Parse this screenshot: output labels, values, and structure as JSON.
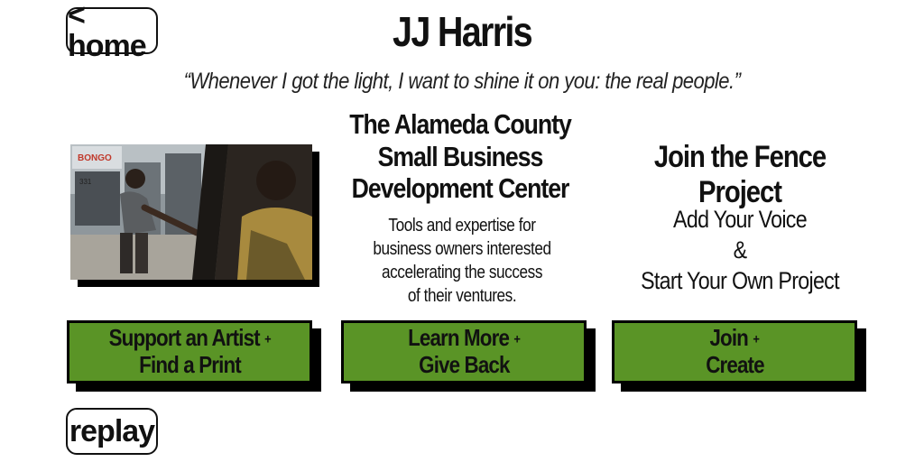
{
  "nav": {
    "home_label": "< home",
    "replay_label": "replay"
  },
  "header": {
    "name": "JJ Harris",
    "quote": "“Whenever I got the light, I want to shine it on you: the real people.”"
  },
  "center_column": {
    "title_lines": [
      "The Alameda County",
      "Small Business",
      "Development Center"
    ],
    "description_lines": [
      "Tools and expertise for",
      "business owners interested",
      "accelerating the success",
      "of their ventures."
    ]
  },
  "right_column": {
    "title": "Join the Fence Project",
    "line1": "Add Your Voice",
    "amp": "&",
    "line2": "Start Your Own Project"
  },
  "buttons": [
    {
      "line1": "Support an Artist",
      "plus": "+",
      "line2": "Find a Print"
    },
    {
      "line1": "Learn More",
      "plus": "+",
      "line2": "Give Back"
    },
    {
      "line1": "Join",
      "plus": "+",
      "line2": "Create"
    }
  ],
  "photo": {
    "storefront_sign": "BONGO",
    "address": "331"
  },
  "colors": {
    "button_green": "#5a9426",
    "shadow": "#000000"
  }
}
